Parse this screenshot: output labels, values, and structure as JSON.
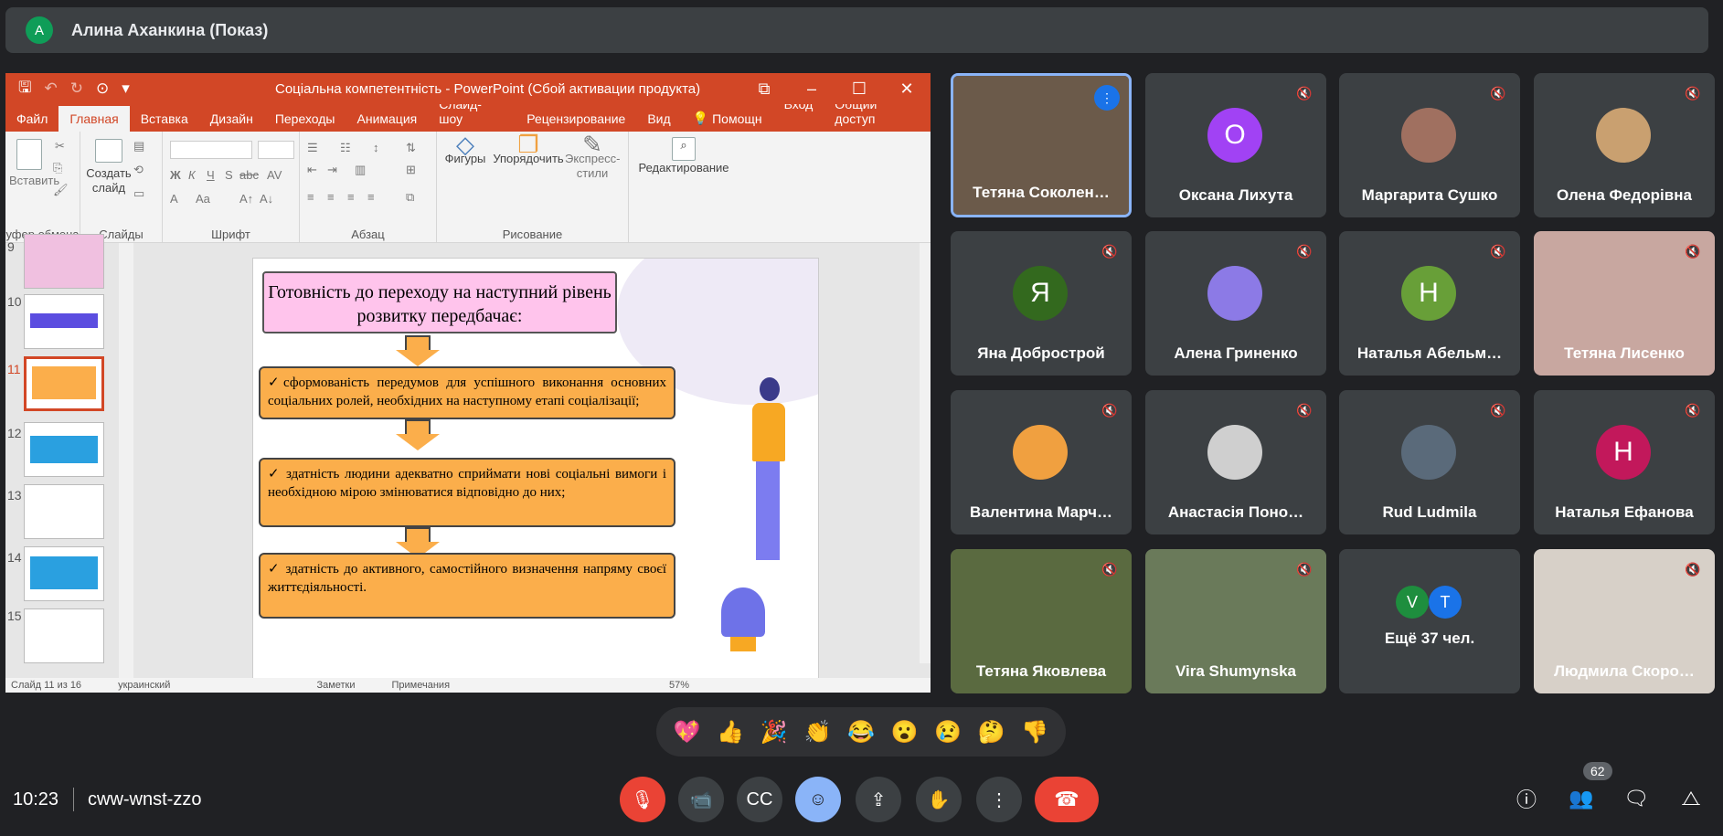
{
  "header": {
    "avatar_letter": "A",
    "title": "Алина Аханкина (Показ)"
  },
  "ppt": {
    "window_title": "Соціальна компетентність - PowerPoint (Сбой активации продукта)",
    "tabs": [
      "Файл",
      "Главная",
      "Вставка",
      "Дизайн",
      "Переходы",
      "Анимация",
      "Слайд-шоу",
      "Рецензирование",
      "Вид"
    ],
    "help": "Помощн",
    "login": "Вход",
    "share": "Общий доступ",
    "groups": {
      "clipboard": "уфер обмена",
      "slides": "Слайды",
      "font": "Шрифт",
      "paragraph": "Абзац",
      "drawing": "Рисование"
    },
    "buttons": {
      "paste": "Вставить",
      "new_slide": "Создать слайд",
      "shapes": "Фигуры",
      "arrange": "Упорядочить",
      "quick_styles": "Экспресс-стили",
      "editing": "Редактирование"
    },
    "thumb_numbers": [
      "9",
      "10",
      "11",
      "12",
      "13",
      "14",
      "15"
    ],
    "status": {
      "slide": "Слайд 11 из 16",
      "lang": "украинский",
      "notes": "Заметки",
      "comments": "Примечания",
      "zoom": "57%"
    },
    "slide": {
      "title": "Готовність до переходу на наступний рівень розвитку передбачає:",
      "items": [
        "✓сформованість передумов для успішного виконання основних соціальних ролей, необхідних на наступному етапі соціалізації;",
        "✓ здатність людини адекватно сприймати нові соціальні вимоги і необхідною мірою змінюватися відповідно до них;",
        "✓ здатність до активного, самостійного визначення напряму своєї життєдіяльності."
      ]
    }
  },
  "participants": [
    {
      "name": "Тетяна Соколен…",
      "type": "photo",
      "color": "#6b5a4a"
    },
    {
      "name": "Оксана Лихута",
      "type": "letter",
      "letter": "О",
      "color": "#a142f4"
    },
    {
      "name": "Маргарита Сушко",
      "type": "photo-avatar",
      "color": "#a07060"
    },
    {
      "name": "Олена Федорівна",
      "type": "photo-avatar",
      "color": "#c9a070"
    },
    {
      "name": "Яна Добрострой",
      "type": "letter",
      "letter": "Я",
      "color": "#33691e"
    },
    {
      "name": "Алена Гриненко",
      "type": "photo-avatar",
      "color": "#8c7ae6"
    },
    {
      "name": "Наталья Абельм…",
      "type": "letter",
      "letter": "Н",
      "color": "#689f38"
    },
    {
      "name": "Тетяна Лисенко",
      "type": "photo",
      "color": "#c8a7a0"
    },
    {
      "name": "Валентина Марч…",
      "type": "photo-avatar",
      "color": "#f0a040"
    },
    {
      "name": "Анастасія Поно…",
      "type": "photo-avatar",
      "color": "#cfcfcf"
    },
    {
      "name": "Rud Ludmila",
      "type": "photo-avatar",
      "color": "#5a6a7a"
    },
    {
      "name": "Наталья Ефанова",
      "type": "letter",
      "letter": "Н",
      "color": "#c2185b"
    },
    {
      "name": "Тетяна Яковлева",
      "type": "photo",
      "color": "#5a6a40"
    },
    {
      "name": "Vira Shumynska",
      "type": "photo",
      "color": "#6a7a5a"
    },
    {
      "name": "Ещё 37 чел.",
      "type": "more",
      "letters": [
        "V",
        "T"
      ]
    },
    {
      "name": "Людмила Скоро…",
      "type": "photo",
      "color": "#d7d0c8"
    }
  ],
  "reactions": [
    "💖",
    "👍",
    "🎉",
    "👏",
    "😂",
    "😮",
    "😢",
    "🤔",
    "👎"
  ],
  "bottom": {
    "time": "10:23",
    "meeting_code": "cww-wnst-zzo",
    "people_count": "62"
  }
}
